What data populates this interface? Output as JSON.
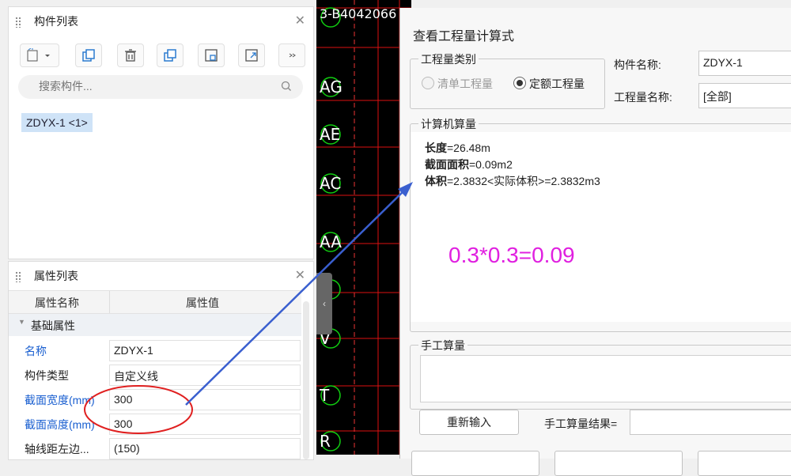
{
  "component_panel": {
    "title": "构件列表",
    "search_placeholder": "搜索构件...",
    "items": [
      "ZDYX-1 <1>"
    ]
  },
  "property_panel": {
    "title": "属性列表",
    "col_name": "属性名称",
    "col_value": "属性值",
    "section": "基础属性",
    "rows": [
      {
        "name": "名称",
        "value": "ZDYX-1"
      },
      {
        "name": "构件类型",
        "value": "自定义线"
      },
      {
        "name": "截面宽度(mm)",
        "value": "300"
      },
      {
        "name": "截面高度(mm)",
        "value": "300"
      },
      {
        "name": "轴线距左边...",
        "value": "(150)"
      }
    ]
  },
  "cad": {
    "axis_labels": [
      "AG",
      "AE",
      "AC",
      "AA",
      "V",
      "T",
      "R"
    ],
    "top_text": "3-B",
    "top_text_2": "4042066"
  },
  "dialog": {
    "title": "查看工程量计算式",
    "qty_type_legend": "工程量类别",
    "radio_bill": "清单工程量",
    "radio_quota": "定额工程量",
    "component_name_label": "构件名称:",
    "component_name_value": "ZDYX-1",
    "qty_name_label": "工程量名称:",
    "qty_name_value": "[全部]",
    "computer_legend": "计算机算量",
    "lines": [
      {
        "key": "长度",
        "value": "=26.48m"
      },
      {
        "key": "截面面积",
        "value": "=0.09m2"
      },
      {
        "key": "体积",
        "value": "=2.3832<实际体积>=2.3832m3"
      }
    ],
    "annotation": "0.3*0.3=0.09",
    "manual_legend": "手工算量",
    "reenter_button": "重新输入",
    "manual_result_label": "手工算量结果="
  },
  "colors": {
    "annotation": "#e020e0",
    "link_blue": "#1a5fd0",
    "arrow": "#3a5fcf",
    "ellipse": "#e02020",
    "cad_line": "#d11"
  }
}
